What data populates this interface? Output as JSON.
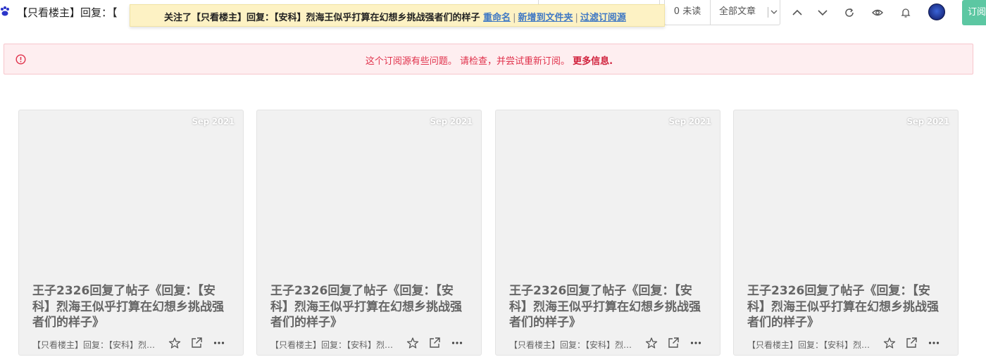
{
  "topbar": {
    "feed_title": "【只看楼主】回复：【",
    "unread_label": "0 未读",
    "filter_selected": "全部文章",
    "subscribe_label": "订阅",
    "icons": [
      "arrow-up",
      "arrow-down",
      "refresh",
      "eye",
      "bell",
      "avatar"
    ]
  },
  "toast": {
    "message": "关注了【只看楼主】回复：【安科】烈海王似乎打算在幻想乡挑战强者们的样子",
    "rename": "重命名",
    "add_to_folder": "新增到文件夹",
    "filter_feed": "过滤订阅源",
    "separator": "|"
  },
  "error_banner": {
    "message": "这个订阅源有些问题。 请检查，并尝试重新订阅。",
    "more_info": "更多信息."
  },
  "cards": [
    {
      "date": "Sep 2021",
      "title": "王子2326回复了帖子《回复：【安科】烈海王似乎打算在幻想乡挑战强者们的样子》",
      "source": "【只看楼主】回复：【安科】烈海王似乎打算在幻想乡挑战强者们的样子"
    },
    {
      "date": "Sep 2021",
      "title": "王子2326回复了帖子《回复：【安科】烈海王似乎打算在幻想乡挑战强者们的样子》",
      "source": "【只看楼主】回复：【安科】烈海王似乎打算在幻想乡挑战强者们的样子"
    },
    {
      "date": "Sep 2021",
      "title": "王子2326回复了帖子《回复：【安科】烈海王似乎打算在幻想乡挑战强者们的样子》",
      "source": "【只看楼主】回复：【安科】烈海王似乎打算在幻想乡挑战强者们的样子"
    },
    {
      "date": "Sep 2021",
      "title": "王子2326回复了帖子《回复：【安科】烈海王似乎打算在幻想乡挑战强者们的样子》",
      "source": "【只看楼主】回复：【安科】烈海王似乎打算在幻想乡挑战强者们的样子"
    }
  ],
  "colors": {
    "toast_bg": "#fdf2c4",
    "link": "#3f78c4",
    "error_text": "#e0314b",
    "error_bg": "#feeef0",
    "subscribe_bg": "#5cc7a2",
    "card_bg": "#f1f1f1"
  }
}
